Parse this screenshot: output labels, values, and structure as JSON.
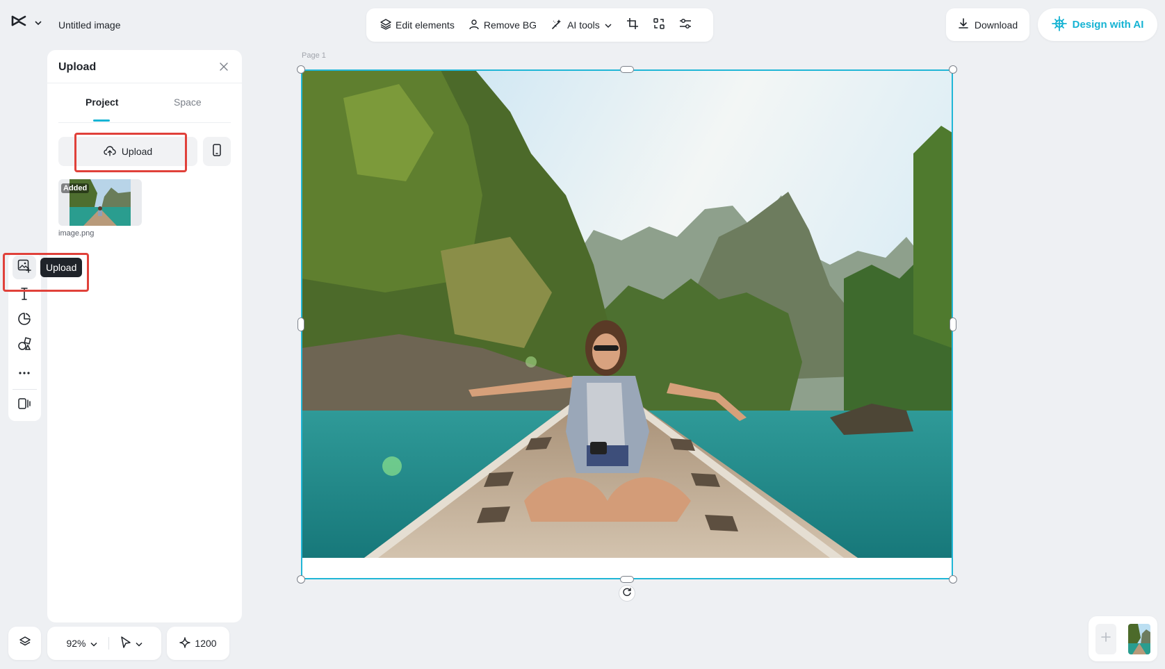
{
  "app": {
    "logo_icon": "capcut-logo-icon",
    "doc_title": "Untitled image"
  },
  "toolbar": {
    "edit_elements": "Edit elements",
    "remove_bg": "Remove BG",
    "ai_tools": "AI tools",
    "icons": [
      "crop-icon",
      "smart-resize-icon",
      "adjust-sliders-icon"
    ]
  },
  "header_right": {
    "download": "Download",
    "design_with_ai": "Design with AI",
    "accent_color": "#15b3d3"
  },
  "rail": {
    "items": [
      "upload-image-icon",
      "text-icon",
      "shapes-icon",
      "elements-icon",
      "more-icon",
      "plugins-icon"
    ],
    "tooltip": "Upload"
  },
  "panel": {
    "title": "Upload",
    "tabs": [
      {
        "label": "Project",
        "active": true
      },
      {
        "label": "Space",
        "active": false
      }
    ],
    "upload_button": "Upload",
    "asset": {
      "badge": "Added",
      "filename": "image.png"
    }
  },
  "canvas": {
    "page_label": "Page 1",
    "selection_color": "#20b6d6"
  },
  "bottom": {
    "zoom": "92%",
    "credits": "1200"
  }
}
